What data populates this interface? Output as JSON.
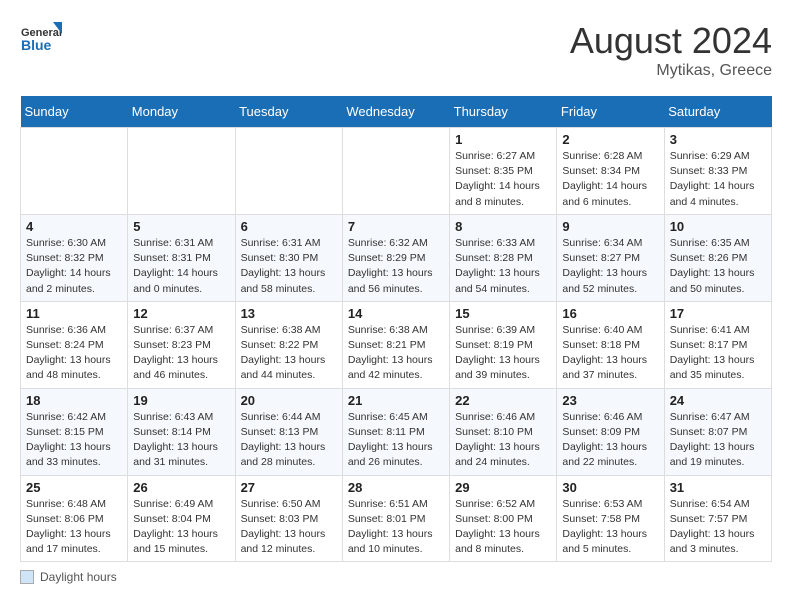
{
  "header": {
    "logo_general": "General",
    "logo_blue": "Blue",
    "month_title": "August 2024",
    "location": "Mytikas, Greece"
  },
  "days_of_week": [
    "Sunday",
    "Monday",
    "Tuesday",
    "Wednesday",
    "Thursday",
    "Friday",
    "Saturday"
  ],
  "footer": {
    "box_label": "Daylight hours"
  },
  "weeks": [
    [
      {
        "day": "",
        "info": ""
      },
      {
        "day": "",
        "info": ""
      },
      {
        "day": "",
        "info": ""
      },
      {
        "day": "",
        "info": ""
      },
      {
        "day": "1",
        "info": "Sunrise: 6:27 AM\nSunset: 8:35 PM\nDaylight: 14 hours\nand 8 minutes."
      },
      {
        "day": "2",
        "info": "Sunrise: 6:28 AM\nSunset: 8:34 PM\nDaylight: 14 hours\nand 6 minutes."
      },
      {
        "day": "3",
        "info": "Sunrise: 6:29 AM\nSunset: 8:33 PM\nDaylight: 14 hours\nand 4 minutes."
      }
    ],
    [
      {
        "day": "4",
        "info": "Sunrise: 6:30 AM\nSunset: 8:32 PM\nDaylight: 14 hours\nand 2 minutes."
      },
      {
        "day": "5",
        "info": "Sunrise: 6:31 AM\nSunset: 8:31 PM\nDaylight: 14 hours\nand 0 minutes."
      },
      {
        "day": "6",
        "info": "Sunrise: 6:31 AM\nSunset: 8:30 PM\nDaylight: 13 hours\nand 58 minutes."
      },
      {
        "day": "7",
        "info": "Sunrise: 6:32 AM\nSunset: 8:29 PM\nDaylight: 13 hours\nand 56 minutes."
      },
      {
        "day": "8",
        "info": "Sunrise: 6:33 AM\nSunset: 8:28 PM\nDaylight: 13 hours\nand 54 minutes."
      },
      {
        "day": "9",
        "info": "Sunrise: 6:34 AM\nSunset: 8:27 PM\nDaylight: 13 hours\nand 52 minutes."
      },
      {
        "day": "10",
        "info": "Sunrise: 6:35 AM\nSunset: 8:26 PM\nDaylight: 13 hours\nand 50 minutes."
      }
    ],
    [
      {
        "day": "11",
        "info": "Sunrise: 6:36 AM\nSunset: 8:24 PM\nDaylight: 13 hours\nand 48 minutes."
      },
      {
        "day": "12",
        "info": "Sunrise: 6:37 AM\nSunset: 8:23 PM\nDaylight: 13 hours\nand 46 minutes."
      },
      {
        "day": "13",
        "info": "Sunrise: 6:38 AM\nSunset: 8:22 PM\nDaylight: 13 hours\nand 44 minutes."
      },
      {
        "day": "14",
        "info": "Sunrise: 6:38 AM\nSunset: 8:21 PM\nDaylight: 13 hours\nand 42 minutes."
      },
      {
        "day": "15",
        "info": "Sunrise: 6:39 AM\nSunset: 8:19 PM\nDaylight: 13 hours\nand 39 minutes."
      },
      {
        "day": "16",
        "info": "Sunrise: 6:40 AM\nSunset: 8:18 PM\nDaylight: 13 hours\nand 37 minutes."
      },
      {
        "day": "17",
        "info": "Sunrise: 6:41 AM\nSunset: 8:17 PM\nDaylight: 13 hours\nand 35 minutes."
      }
    ],
    [
      {
        "day": "18",
        "info": "Sunrise: 6:42 AM\nSunset: 8:15 PM\nDaylight: 13 hours\nand 33 minutes."
      },
      {
        "day": "19",
        "info": "Sunrise: 6:43 AM\nSunset: 8:14 PM\nDaylight: 13 hours\nand 31 minutes."
      },
      {
        "day": "20",
        "info": "Sunrise: 6:44 AM\nSunset: 8:13 PM\nDaylight: 13 hours\nand 28 minutes."
      },
      {
        "day": "21",
        "info": "Sunrise: 6:45 AM\nSunset: 8:11 PM\nDaylight: 13 hours\nand 26 minutes."
      },
      {
        "day": "22",
        "info": "Sunrise: 6:46 AM\nSunset: 8:10 PM\nDaylight: 13 hours\nand 24 minutes."
      },
      {
        "day": "23",
        "info": "Sunrise: 6:46 AM\nSunset: 8:09 PM\nDaylight: 13 hours\nand 22 minutes."
      },
      {
        "day": "24",
        "info": "Sunrise: 6:47 AM\nSunset: 8:07 PM\nDaylight: 13 hours\nand 19 minutes."
      }
    ],
    [
      {
        "day": "25",
        "info": "Sunrise: 6:48 AM\nSunset: 8:06 PM\nDaylight: 13 hours\nand 17 minutes."
      },
      {
        "day": "26",
        "info": "Sunrise: 6:49 AM\nSunset: 8:04 PM\nDaylight: 13 hours\nand 15 minutes."
      },
      {
        "day": "27",
        "info": "Sunrise: 6:50 AM\nSunset: 8:03 PM\nDaylight: 13 hours\nand 12 minutes."
      },
      {
        "day": "28",
        "info": "Sunrise: 6:51 AM\nSunset: 8:01 PM\nDaylight: 13 hours\nand 10 minutes."
      },
      {
        "day": "29",
        "info": "Sunrise: 6:52 AM\nSunset: 8:00 PM\nDaylight: 13 hours\nand 8 minutes."
      },
      {
        "day": "30",
        "info": "Sunrise: 6:53 AM\nSunset: 7:58 PM\nDaylight: 13 hours\nand 5 minutes."
      },
      {
        "day": "31",
        "info": "Sunrise: 6:54 AM\nSunset: 7:57 PM\nDaylight: 13 hours\nand 3 minutes."
      }
    ]
  ]
}
